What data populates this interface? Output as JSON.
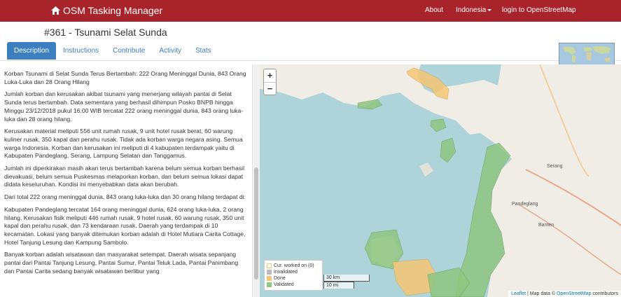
{
  "navbar": {
    "brand": "OSM Tasking Manager",
    "about": "About",
    "language": "Indonesia",
    "login": "login to OpenStreetMap"
  },
  "project": {
    "title": "#361 - Tsunami Selat Sunda"
  },
  "tabs": [
    {
      "label": "Description"
    },
    {
      "label": "Instructions"
    },
    {
      "label": "Contribute"
    },
    {
      "label": "Activity"
    },
    {
      "label": "Stats"
    }
  ],
  "description": {
    "paragraphs": [
      "Korban Tsunami di Selat Sunda Terus Bertambah: 222 Orang Meninggal Dunia, 843 Orang Luka-Luka dan 28 Orang Hilang",
      "Jumlah korban dan kerusakan akibat tsunami yang menerjang wilayah pantai di Selat Sunda terus bertambah. Data sementara yang berhasil dihimpun Posko BNPB hingga Minggu 23/12/2018 pukul 16.00 WIB tercatat 222 orang meninggal dunia, 843 orang luka-luka dan 28 orang hilang.",
      "Kerusakan material meliputi 556 unit rumah rusak, 9 unit hotel rusak berat, 60 warung kuliner rusak, 350 kapal dan perahu rusak. Tidak ada korban warga negara asing. Semua warga Indonesia. Korban dan kerusakan ini meliputi di 4 kabupaten terdampak yaitu di Kabupaten Pandeglang, Serang, Lampung Selatan dan Tanggamus.",
      "Jumlah ini diperkirakan masih akan terus bertambah karena belum semua korban berhasil dievakuasi, belum semua Puskesmas melaporkan korban, dan belum semua lokasi dapat didata keseluruhan. Kondisi ini menyebabkan data akan berubah.",
      "Dari total 222 orang meninggal dunia, 843 orang luka-luka dan 30 orang hilang terdapat di:",
      "Kabupaten Pandeglang tercatat 164 orang meninggal dunia, 624 orang luka-luka, 2 orang hilang. Kerusakan fisik meliputi 446 rumah rusak, 9 hotel rusak, 60 warung rusak, 350 unit kapal dan perahu rusak, dan 73 kendaraan rusak. Daerah yang terdampak di 10 kecamatan. Lokasi yang banyak ditemukan korban adalah di Hotel Mutiara Carita Cottage, Hotel Tanjung Lesung dan Kampung Sambolo.",
      "Banyak korban adalah wisatawan dan masyarakat setempat. Daerah wisata sepanjang pantai dari Pantai Tanjung Lesung, Pantai Sumur, Pantai Teluk Lada, Pantai Panimbang dan Pantai Carita sedang banyak wisatawan berlibur yang"
    ]
  },
  "map": {
    "zoom_in": "+",
    "zoom_out": "−",
    "legend": [
      {
        "label": "Cur. worked on (0)",
        "color": "#ffffff"
      },
      {
        "label": "Invalidated",
        "color": "#bbbbbb"
      },
      {
        "label": "Done",
        "color": "#f5c775"
      },
      {
        "label": "Validated",
        "color": "#8fc680"
      }
    ],
    "scale_km": "30 km",
    "scale_mi": "10 mi",
    "place_labels": [
      "Serang",
      "Pandeglang",
      "Banten"
    ],
    "attribution": {
      "leaflet": "Leaflet",
      "sep": " | Map data © ",
      "osm": "OpenStreetMap",
      "tail": " contributors"
    },
    "colors": {
      "sea": "#aed3d9",
      "land": "#f0ede6",
      "done": "#f5c775",
      "validated": "#8fc680"
    }
  }
}
